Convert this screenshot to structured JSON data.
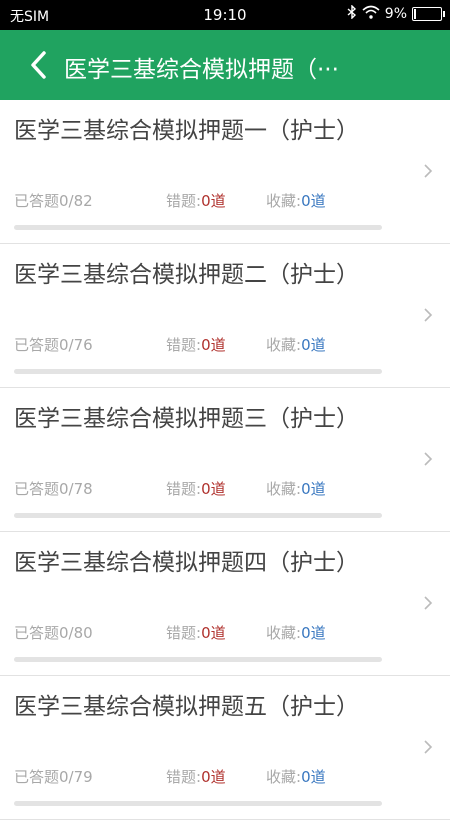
{
  "status_bar": {
    "carrier": "无SIM",
    "time": "19:10",
    "battery_text": "9%",
    "battery_level": 0.09
  },
  "header": {
    "title": "医学三基综合模拟押题（···"
  },
  "items": [
    {
      "name": "医学三基综合模拟押题一（护士）",
      "answered": "已答题0/82",
      "wrong_label": "错题:",
      "wrong_value": "0道",
      "fav_label": "收藏:",
      "fav_value": "0道",
      "progress": 0
    },
    {
      "name": "医学三基综合模拟押题二（护士）",
      "answered": "已答题0/76",
      "wrong_label": "错题:",
      "wrong_value": "0道",
      "fav_label": "收藏:",
      "fav_value": "0道",
      "progress": 0
    },
    {
      "name": "医学三基综合模拟押题三（护士）",
      "answered": "已答题0/78",
      "wrong_label": "错题:",
      "wrong_value": "0道",
      "fav_label": "收藏:",
      "fav_value": "0道",
      "progress": 0
    },
    {
      "name": "医学三基综合模拟押题四（护士）",
      "answered": "已答题0/80",
      "wrong_label": "错题:",
      "wrong_value": "0道",
      "fav_label": "收藏:",
      "fav_value": "0道",
      "progress": 0
    },
    {
      "name": "医学三基综合模拟押题五（护士）",
      "answered": "已答题0/79",
      "wrong_label": "错题:",
      "wrong_value": "0道",
      "fav_label": "收藏:",
      "fav_value": "0道",
      "progress": 0
    }
  ],
  "colors": {
    "accent": "#20a360",
    "wrong": "#b0322e",
    "favorite": "#3a78c0"
  },
  "icons": {
    "back": "chevron-left-icon",
    "item_arrow": "chevron-right-icon",
    "bluetooth": "bluetooth-icon",
    "wifi": "wifi-icon",
    "battery": "battery-icon"
  }
}
